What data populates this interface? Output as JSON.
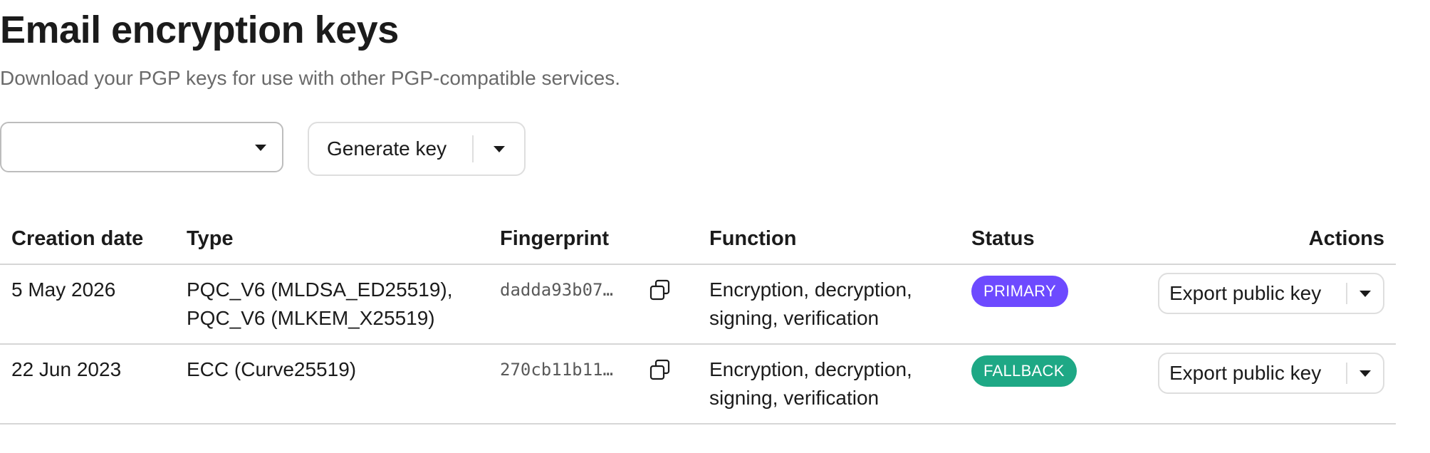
{
  "header": {
    "title": "Email encryption keys",
    "subtitle": "Download your PGP keys for use with other PGP-compatible services."
  },
  "controls": {
    "address_select_value": "",
    "generate_label": "Generate key"
  },
  "table": {
    "columns": {
      "creation_date": "Creation date",
      "type": "Type",
      "fingerprint": "Fingerprint",
      "function": "Function",
      "status": "Status",
      "actions": "Actions"
    },
    "rows": [
      {
        "creation_date": "5 May 2026",
        "type_line1": "PQC_V6 (MLDSA_ED25519),",
        "type_line2": "PQC_V6 (MLKEM_X25519)",
        "fingerprint": "dadda93b07…",
        "function_line1": "Encryption, decryption,",
        "function_line2": "signing, verification",
        "status": "PRIMARY",
        "action_label": "Export public key"
      },
      {
        "creation_date": "22 Jun 2023",
        "type_line1": "ECC (Curve25519)",
        "type_line2": "",
        "fingerprint": "270cb11b11…",
        "function_line1": "Encryption, decryption,",
        "function_line2": "signing, verification",
        "status": "FALLBACK",
        "action_label": "Export public key"
      }
    ]
  },
  "colors": {
    "primary_badge": "#6d4aff",
    "fallback_badge": "#1ea885",
    "subtitle_text": "#6a6a6a",
    "border": "#d6d6d6"
  },
  "icons": {
    "dropdown": "chevron-down-icon",
    "copy": "copy-icon"
  }
}
